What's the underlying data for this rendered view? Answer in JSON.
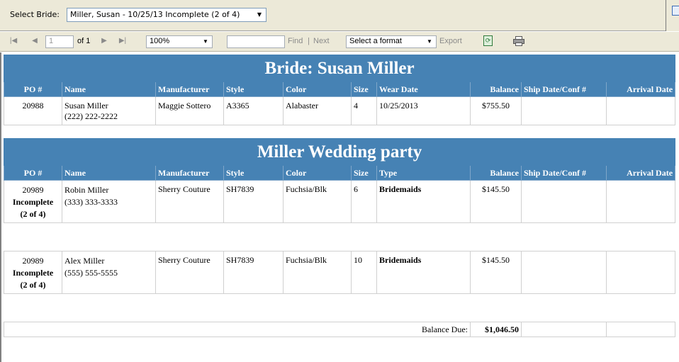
{
  "params": {
    "label": "Select Bride:",
    "selected": "Miller, Susan - 10/25/13 Incomplete (2 of 4)"
  },
  "toolbar": {
    "page_value": "1",
    "page_of": "of 1",
    "zoom": "100%",
    "find": "Find",
    "separator": "|",
    "next": "Next",
    "format": "Select a format",
    "export": "Export"
  },
  "bride_section": {
    "title": "Bride: Susan Miller",
    "headers": [
      "PO #",
      "Name",
      "Manufacturer",
      "Style",
      "Color",
      "Size",
      "Wear Date",
      "Balance",
      "Ship Date/Conf #",
      "Arrival Date"
    ],
    "rows": [
      {
        "po": "20988",
        "name": "Susan Miller",
        "phone": "(222) 222-2222",
        "manufacturer": "Maggie Sottero",
        "style": "A3365",
        "color": "Alabaster",
        "size": "4",
        "wear_date": "10/25/2013",
        "balance": "$755.50",
        "ship": "",
        "arrival": ""
      }
    ]
  },
  "party_section": {
    "title": "Miller Wedding party",
    "headers": [
      "PO #",
      "Name",
      "Manufacturer",
      "Style",
      "Color",
      "Size",
      "Type",
      "Balance",
      "Ship Date/Conf #",
      "Arrival Date"
    ],
    "rows": [
      {
        "po": "20989",
        "status": "Incomplete",
        "count": "(2 of 4)",
        "name": "Robin Miller",
        "phone": "(333) 333-3333",
        "manufacturer": "Sherry Couture",
        "style": "SH7839",
        "color": "Fuchsia/Blk",
        "size": "6",
        "type": "Bridemaids",
        "balance": "$145.50",
        "ship": "",
        "arrival": ""
      },
      {
        "po": "20989",
        "status": "Incomplete",
        "count": "(2 of 4)",
        "name": "Alex Miller",
        "phone": "(555) 555-5555",
        "manufacturer": "Sherry Couture",
        "style": "SH7839",
        "color": "Fuchsia/Blk",
        "size": "10",
        "type": "Bridemaids",
        "balance": "$145.50",
        "ship": "",
        "arrival": ""
      }
    ]
  },
  "totals": {
    "label": "Balance Due:",
    "value": "$1,046.50"
  }
}
